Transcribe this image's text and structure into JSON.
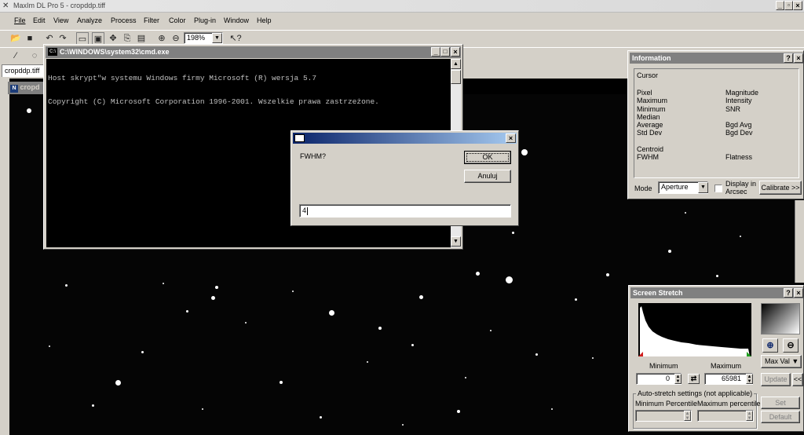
{
  "app": {
    "title": "MaxIm DL Pro 5 - cropddp.tiff",
    "menu": [
      "File",
      "Edit",
      "View",
      "Analyze",
      "Process",
      "Filter",
      "Color",
      "Plug-in",
      "Window",
      "Help"
    ],
    "zoom": "198%",
    "doc_tab": "cropddp.tiff",
    "image_window_title": "cropd"
  },
  "cmd": {
    "title": "C:\\WINDOWS\\system32\\cmd.exe",
    "line1": "Host skrypt\"w systemu Windows firmy Microsoft (R) wersja 5.7",
    "line2": "Copyright (C) Microsoft Corporation 1996-2001. Wszelkie prawa zastrzeżone."
  },
  "dialog": {
    "prompt": "FWHM?",
    "ok_label": "OK",
    "cancel_label": "Anuluj",
    "input_value": "4"
  },
  "info": {
    "title": "Information",
    "cursor": "Cursor",
    "left_labels": [
      "Pixel",
      "Maximum",
      "Minimum",
      "Median",
      "Average",
      "Std Dev",
      "",
      "Centroid",
      "FWHM"
    ],
    "right_labels": [
      "Magnitude",
      "Intensity",
      "SNR",
      "",
      "Bgd Avg",
      "Bgd Dev",
      "",
      "",
      "Flatness"
    ],
    "mode_label": "Mode",
    "mode_value": "Aperture",
    "arcsec_label_1": "Display in",
    "arcsec_label_2": "Arcsec",
    "calibrate_label": "Calibrate >>"
  },
  "stretch": {
    "title": "Screen Stretch",
    "min_label": "Minimum",
    "max_label": "Maximum",
    "min_value": "0",
    "max_value": "65981",
    "maxval_label": "Max Val",
    "update_label": "Update",
    "more_label": "<<",
    "auto_label": "Auto-stretch settings (not applicable)",
    "min_pct_label": "Minimum Percentile",
    "max_pct_label": "Maximum percentile",
    "set_label": "Set",
    "default_label": "Default"
  },
  "icons": {
    "app_icon": "maxim-icon",
    "cmd_icon": "cmd-icon"
  }
}
